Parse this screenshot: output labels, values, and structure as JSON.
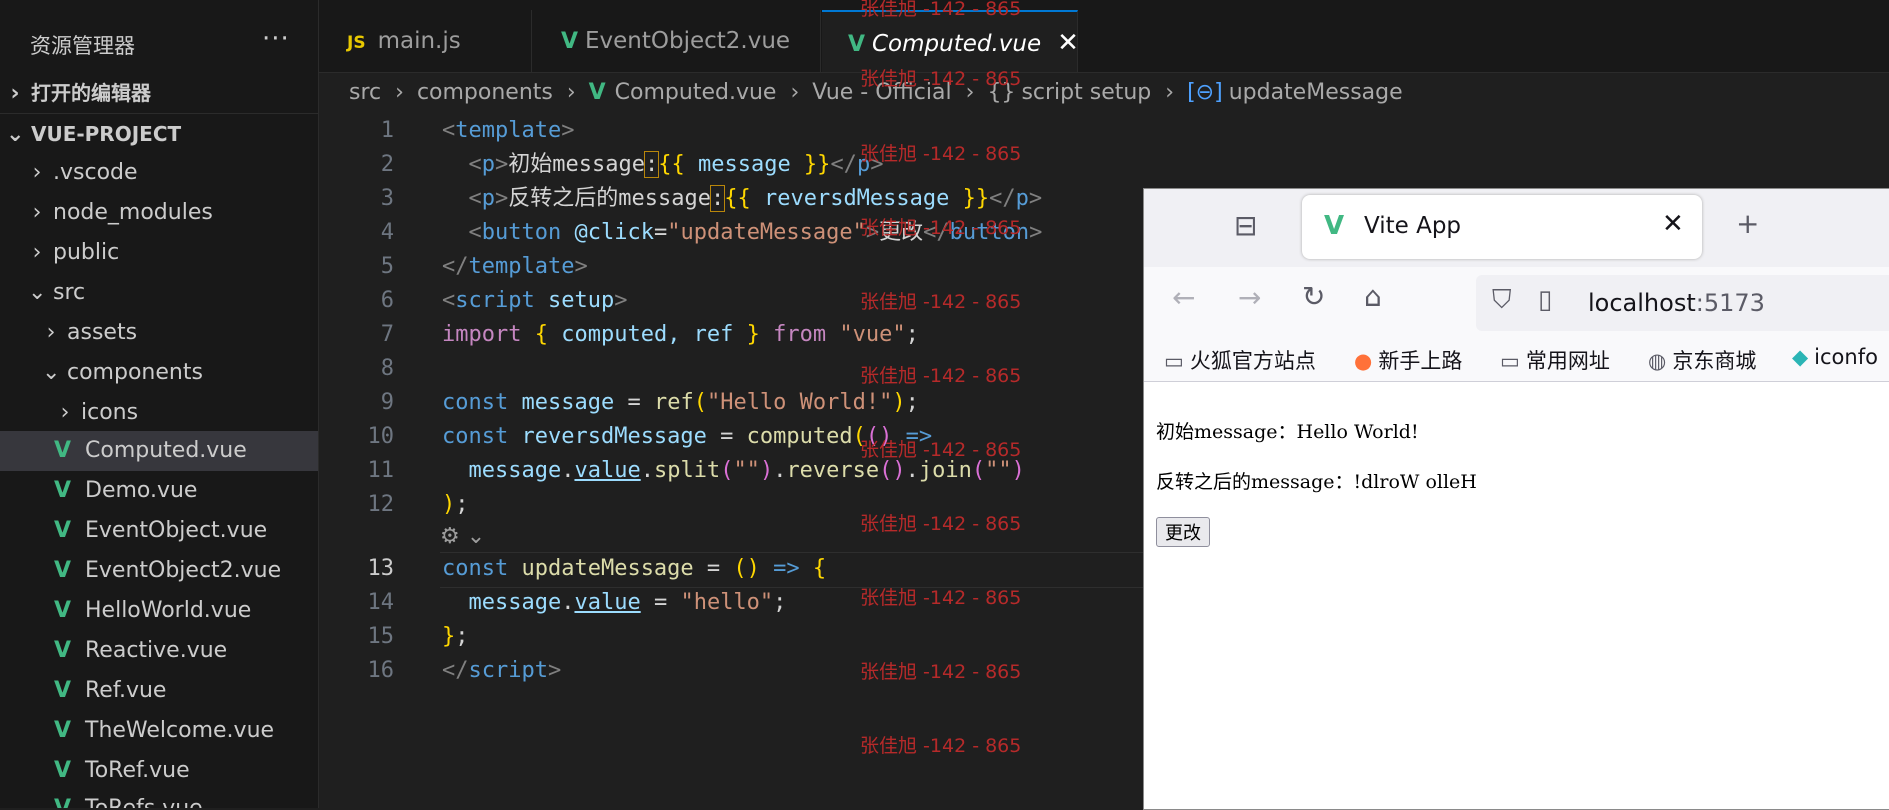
{
  "explorer": {
    "title": "资源管理器",
    "more": "···",
    "open_editors": "打开的编辑器",
    "project": "VUE-PROJECT",
    "folders": [
      ".vscode",
      "node_modules",
      "public",
      "src",
      "assets",
      "components",
      "icons"
    ],
    "files": [
      "Computed.vue",
      "Demo.vue",
      "EventObject.vue",
      "EventObject2.vue",
      "HelloWorld.vue",
      "Reactive.vue",
      "Ref.vue",
      "TheWelcome.vue",
      "ToRef.vue",
      "ToRefs.vue"
    ]
  },
  "tabs": [
    {
      "label": "main.js",
      "icon": "JS"
    },
    {
      "label": "EventObject2.vue",
      "icon": "V"
    },
    {
      "label": "Computed.vue",
      "icon": "V",
      "active": true
    }
  ],
  "breadcrumb": [
    "src",
    "components",
    "Computed.vue",
    "Vue - Official",
    "script setup",
    "updateMessage"
  ],
  "line_numbers": [
    "1",
    "2",
    "3",
    "4",
    "5",
    "6",
    "7",
    "8",
    "9",
    "10",
    "11",
    "12",
    "13",
    "14",
    "15",
    "16"
  ],
  "code": {
    "l1_tag": "template",
    "l2_p": "p",
    "l2_txt": "初始message",
    "l2_colon": ":",
    "l2_expr": "message",
    "l3_p": "p",
    "l3_txt": "反转之后的message",
    "l3_colon": ":",
    "l3_expr": "reversdMessage",
    "l4_button": "button",
    "l4_attr": "@click",
    "l4_val": "\"updateMessage\"",
    "l4_txt": "更改",
    "l5_tag": "template",
    "l6_tag": "script",
    "l6_attr": "setup",
    "l7_import": "import",
    "l7_names": "computed, ref",
    "l7_from": "from",
    "l7_mod": "\"vue\"",
    "l9_const": "const",
    "l9_var": "message",
    "l9_fn": "ref",
    "l9_str": "\"Hello World!\"",
    "l10_const": "const",
    "l10_var": "reversdMessage",
    "l10_fn": "computed",
    "l11_obj": "message",
    "l11_prop": "value",
    "l11_m1": "split",
    "l11_s1": "\"\"",
    "l11_m2": "reverse",
    "l11_m3": "join",
    "l11_s2": "\"\"",
    "l13_const": "const",
    "l13_var": "updateMessage",
    "l14_obj": "message",
    "l14_prop": "value",
    "l14_str": "\"hello\"",
    "l16_tag": "script"
  },
  "watermark": "张佳旭 -142 - 865",
  "browser": {
    "tab_title": "Vite App",
    "url_host": "localhost",
    "url_port": ":5173",
    "bookmarks": [
      "火狐官方站点",
      "新手上路",
      "常用网址",
      "京东商城",
      "iconfo"
    ],
    "line1": "初始message：Hello World!",
    "line2": "反转之后的message：!dlroW olleH",
    "button": "更改"
  }
}
